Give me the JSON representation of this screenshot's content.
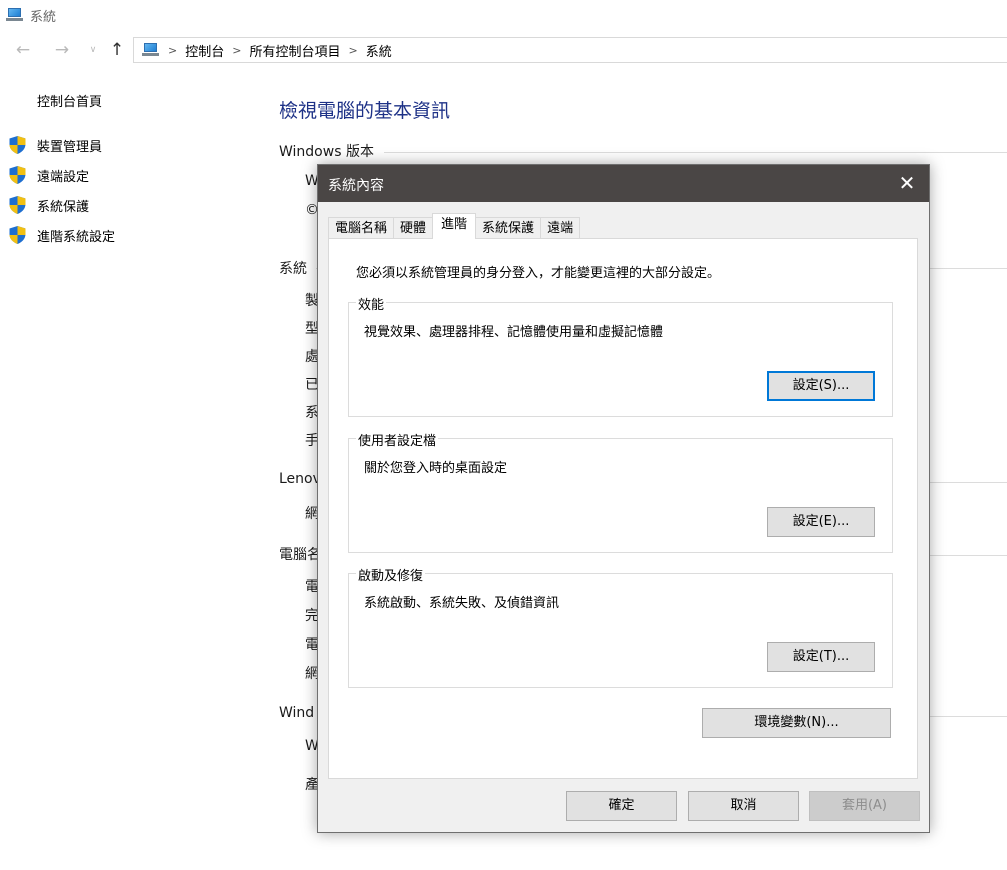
{
  "window": {
    "title": "系統"
  },
  "nav": {
    "back": "←",
    "forward": "→",
    "dropdown": "∨",
    "up": "↑",
    "separator": ">",
    "breadcrumb": [
      "控制台",
      "所有控制台項目",
      "系統"
    ]
  },
  "sidebar": {
    "home": "控制台首頁",
    "items": [
      {
        "label": "裝置管理員",
        "icon": "shield-icon"
      },
      {
        "label": "遠端設定",
        "icon": "shield-icon"
      },
      {
        "label": "系統保護",
        "icon": "shield-icon"
      },
      {
        "label": "進階系統設定",
        "icon": "shield-icon"
      }
    ]
  },
  "main": {
    "title": "檢視電腦的基本資訊",
    "sections": [
      {
        "heading": "Windows 版本",
        "rows": [
          "W",
          "©"
        ]
      },
      {
        "heading": "系統",
        "rows": [
          "製",
          "型",
          "處",
          "已",
          "系",
          "手"
        ]
      },
      {
        "heading": "Lenov",
        "rows": [
          "網"
        ]
      },
      {
        "heading": "電腦名",
        "rows": [
          "電",
          "完",
          "電",
          "網"
        ]
      },
      {
        "heading": "Wind",
        "rows": [
          "W",
          "產"
        ]
      }
    ]
  },
  "dialog": {
    "title": "系統內容",
    "close": "✕",
    "tabs": [
      "電腦名稱",
      "硬體",
      "進階",
      "系統保護",
      "遠端"
    ],
    "active_tab": 2,
    "notice": "您必須以系統管理員的身分登入，才能變更這裡的大部分設定。",
    "groups": [
      {
        "label": "效能",
        "desc": "視覺效果、處理器排程、記憶體使用量和虛擬記憶體",
        "button": "設定(S)..."
      },
      {
        "label": "使用者設定檔",
        "desc": "關於您登入時的桌面設定",
        "button": "設定(E)..."
      },
      {
        "label": "啟動及修復",
        "desc": "系統啟動、系統失敗、及偵錯資訊",
        "button": "設定(T)..."
      }
    ],
    "env_button": "環境變數(N)...",
    "ok": "確定",
    "cancel": "取消",
    "apply": "套用(A)"
  },
  "colors": {
    "title_blue": "#1e3287",
    "dialog_titlebar": "#4a4645",
    "focus_border": "#0078d7",
    "shield_blue": "#1e6fd0",
    "shield_yellow": "#f2c012"
  }
}
